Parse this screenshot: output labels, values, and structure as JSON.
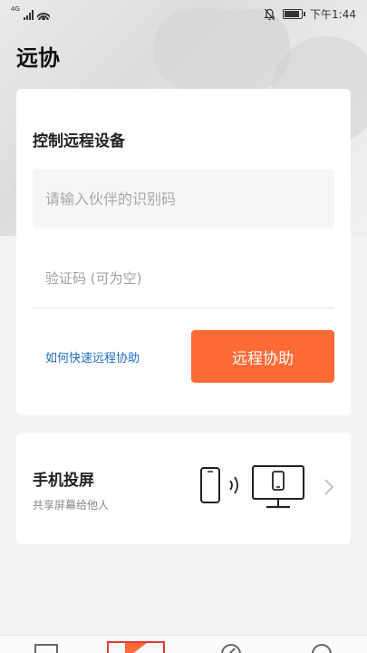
{
  "status_bar": {
    "network": "4G",
    "time": "下午1:44"
  },
  "app": {
    "title": "远协"
  },
  "remote_control": {
    "title": "控制远程设备",
    "partner_id_placeholder": "请输入伙伴的识别码",
    "verify_code_placeholder": "验证码 (可为空)",
    "help_link": "如何快速远程协助",
    "assist_button": "远程协助",
    "accent_color": "#ff6a35",
    "link_color": "#1f6fc5"
  },
  "screen_cast": {
    "title": "手机投屏",
    "subtitle": "共享屏幕给他人",
    "illustration_icon": "phone-to-monitor-cast-icon"
  },
  "bottom_nav": {
    "icons": [
      "home-square-icon",
      "play-icon",
      "compass-icon",
      "profile-icon"
    ]
  }
}
